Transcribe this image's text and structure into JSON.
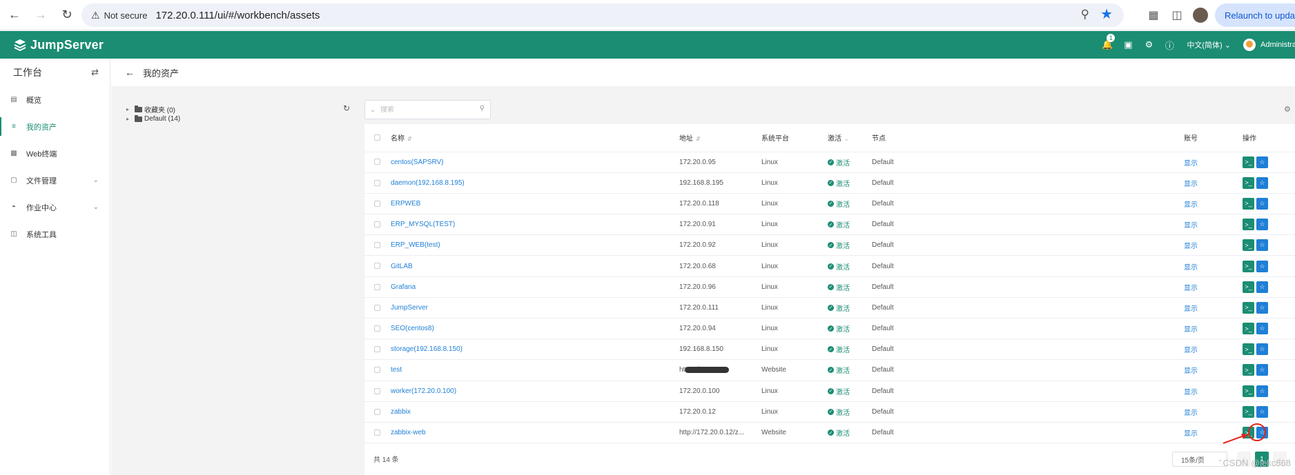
{
  "browser": {
    "not_secure_label": "Not secure",
    "url": "172.20.0.111/ui/#/workbench/assets",
    "relaunch_label": "Relaunch to update"
  },
  "header": {
    "brand": "JumpServer",
    "notification_count": "1",
    "language": "中文(简体)",
    "user_name": "Administrator"
  },
  "sidebar": {
    "title": "工作台",
    "items": [
      {
        "label": "概览",
        "icon": "overview-icon"
      },
      {
        "label": "我的资产",
        "icon": "assets-icon",
        "active": true
      },
      {
        "label": "Web终端",
        "icon": "terminal-icon"
      },
      {
        "label": "文件管理",
        "icon": "folder-icon",
        "expandable": true
      },
      {
        "label": "作业中心",
        "icon": "job-icon",
        "expandable": true
      },
      {
        "label": "系统工具",
        "icon": "tools-icon"
      }
    ]
  },
  "page": {
    "title": "我的资产"
  },
  "tree": {
    "nodes": [
      {
        "label": "收藏夹 (0)"
      },
      {
        "label": "Default (14)"
      }
    ]
  },
  "search": {
    "placeholder": "搜索"
  },
  "table": {
    "headers": {
      "name": "名称",
      "address": "地址",
      "platform": "系统平台",
      "active": "激活",
      "node": "节点",
      "account": "账号",
      "actions": "操作"
    },
    "rows": [
      {
        "name": "centos(SAPSRV)",
        "address": "172.20.0.95",
        "platform": "Linux",
        "status": "激活",
        "node": "Default",
        "account": "显示"
      },
      {
        "name": "daemon(192.168.8.195)",
        "address": "192.168.8.195",
        "platform": "Linux",
        "status": "激活",
        "node": "Default",
        "account": "显示"
      },
      {
        "name": "ERPWEB",
        "address": "172.20.0.118",
        "platform": "Linux",
        "status": "激活",
        "node": "Default",
        "account": "显示"
      },
      {
        "name": "ERP_MYSQL(TEST)",
        "address": "172.20.0.91",
        "platform": "Linux",
        "status": "激活",
        "node": "Default",
        "account": "显示"
      },
      {
        "name": "ERP_WEB(test)",
        "address": "172.20.0.92",
        "platform": "Linux",
        "status": "激活",
        "node": "Default",
        "account": "显示"
      },
      {
        "name": "GitLAB",
        "address": "172.20.0.68",
        "platform": "Linux",
        "status": "激活",
        "node": "Default",
        "account": "显示"
      },
      {
        "name": "Grafana",
        "address": "172.20.0.96",
        "platform": "Linux",
        "status": "激活",
        "node": "Default",
        "account": "显示"
      },
      {
        "name": "JumpServer",
        "address": "172.20.0.111",
        "platform": "Linux",
        "status": "激活",
        "node": "Default",
        "account": "显示"
      },
      {
        "name": "SEO(centos8)",
        "address": "172.20.0.94",
        "platform": "Linux",
        "status": "激活",
        "node": "Default",
        "account": "显示"
      },
      {
        "name": "storage(192.168.8.150)",
        "address": "192.168.8.150",
        "platform": "Linux",
        "status": "激活",
        "node": "Default",
        "account": "显示"
      },
      {
        "name": "test",
        "address": "https://",
        "platform": "Website",
        "status": "激活",
        "node": "Default",
        "account": "显示",
        "redacted": true
      },
      {
        "name": "worker(172.20.0.100)",
        "address": "172.20.0.100",
        "platform": "Linux",
        "status": "激活",
        "node": "Default",
        "account": "显示"
      },
      {
        "name": "zabbix",
        "address": "172.20.0.12",
        "platform": "Linux",
        "status": "激活",
        "node": "Default",
        "account": "显示"
      },
      {
        "name": "zabbix-web",
        "address": "http://172.20.0.12/z...",
        "platform": "Website",
        "status": "激活",
        "node": "Default",
        "account": "显示"
      }
    ]
  },
  "footer": {
    "total": "共 14 条",
    "page_size": "15条/页",
    "current_page": "1"
  },
  "watermark": "CSDN @jekc868",
  "colors": {
    "brand": "#1b8d73",
    "link": "#1f7fd6",
    "annotation": "#e5231a"
  }
}
